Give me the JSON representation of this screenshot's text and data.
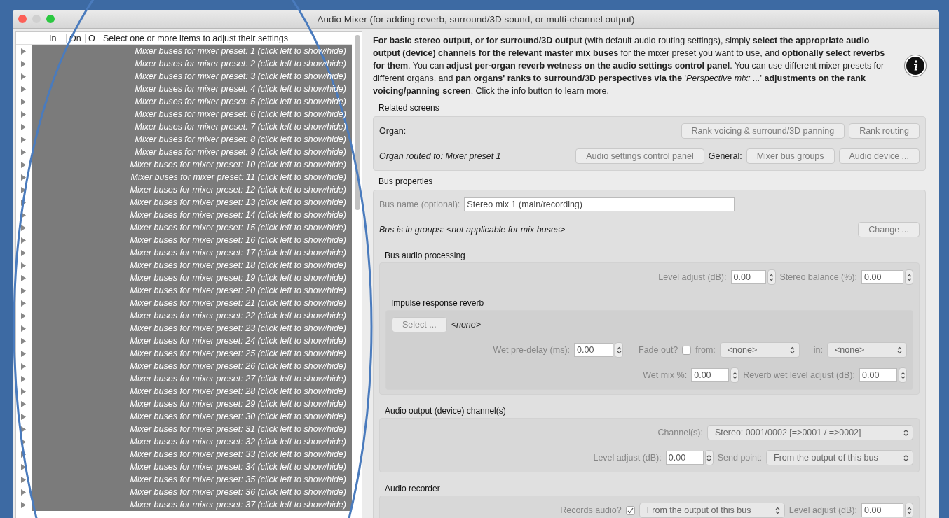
{
  "window": {
    "title": "Audio Mixer (for adding reverb, surround/3D sound, or multi-channel output)"
  },
  "list": {
    "columns": [
      "In",
      "On",
      "O",
      "Select one or more items to adjust their settings"
    ],
    "rows": [
      {
        "label": "Mixer buses for mixer preset: 1 (click left to show/hide)",
        "selected": true,
        "expanded": false
      },
      {
        "label": "Mixer buses for mixer preset: 2 (click left to show/hide)",
        "selected": true,
        "expanded": false
      },
      {
        "label": "Mixer buses for mixer preset: 3 (click left to show/hide)",
        "selected": true,
        "expanded": false
      },
      {
        "label": "Mixer buses for mixer preset: 4 (click left to show/hide)",
        "selected": true,
        "expanded": false
      },
      {
        "label": "Mixer buses for mixer preset: 5 (click left to show/hide)",
        "selected": true,
        "expanded": false
      },
      {
        "label": "Mixer buses for mixer preset: 6 (click left to show/hide)",
        "selected": true,
        "expanded": false
      },
      {
        "label": "Mixer buses for mixer preset: 7 (click left to show/hide)",
        "selected": true,
        "expanded": false
      },
      {
        "label": "Mixer buses for mixer preset: 8 (click left to show/hide)",
        "selected": true,
        "expanded": false
      },
      {
        "label": "Mixer buses for mixer preset: 9 (click left to show/hide)",
        "selected": true,
        "expanded": false
      },
      {
        "label": "Mixer buses for mixer preset: 10 (click left to show/hide)",
        "selected": true,
        "expanded": false
      },
      {
        "label": "Mixer buses for mixer preset: 11 (click left to show/hide)",
        "selected": true,
        "expanded": false
      },
      {
        "label": "Mixer buses for mixer preset: 12 (click left to show/hide)",
        "selected": true,
        "expanded": false
      },
      {
        "label": "Mixer buses for mixer preset: 13 (click left to show/hide)",
        "selected": true,
        "expanded": false
      },
      {
        "label": "Mixer buses for mixer preset: 14 (click left to show/hide)",
        "selected": true,
        "expanded": false
      },
      {
        "label": "Mixer buses for mixer preset: 15 (click left to show/hide)",
        "selected": true,
        "expanded": false
      },
      {
        "label": "Mixer buses for mixer preset: 16 (click left to show/hide)",
        "selected": true,
        "expanded": false
      },
      {
        "label": "Mixer buses for mixer preset: 17 (click left to show/hide)",
        "selected": true,
        "expanded": false
      },
      {
        "label": "Mixer buses for mixer preset: 18 (click left to show/hide)",
        "selected": true,
        "expanded": false
      },
      {
        "label": "Mixer buses for mixer preset: 19 (click left to show/hide)",
        "selected": true,
        "expanded": false
      },
      {
        "label": "Mixer buses for mixer preset: 20 (click left to show/hide)",
        "selected": true,
        "expanded": false
      },
      {
        "label": "Mixer buses for mixer preset: 21 (click left to show/hide)",
        "selected": true,
        "expanded": false
      },
      {
        "label": "Mixer buses for mixer preset: 22 (click left to show/hide)",
        "selected": true,
        "expanded": false
      },
      {
        "label": "Mixer buses for mixer preset: 23 (click left to show/hide)",
        "selected": true,
        "expanded": false
      },
      {
        "label": "Mixer buses for mixer preset: 24 (click left to show/hide)",
        "selected": true,
        "expanded": false
      },
      {
        "label": "Mixer buses for mixer preset: 25 (click left to show/hide)",
        "selected": true,
        "expanded": false
      },
      {
        "label": "Mixer buses for mixer preset: 26 (click left to show/hide)",
        "selected": true,
        "expanded": false
      },
      {
        "label": "Mixer buses for mixer preset: 27 (click left to show/hide)",
        "selected": true,
        "expanded": false
      },
      {
        "label": "Mixer buses for mixer preset: 28 (click left to show/hide)",
        "selected": true,
        "expanded": false
      },
      {
        "label": "Mixer buses for mixer preset: 29 (click left to show/hide)",
        "selected": true,
        "expanded": false
      },
      {
        "label": "Mixer buses for mixer preset: 30 (click left to show/hide)",
        "selected": true,
        "expanded": false
      },
      {
        "label": "Mixer buses for mixer preset: 31 (click left to show/hide)",
        "selected": true,
        "expanded": false
      },
      {
        "label": "Mixer buses for mixer preset: 32 (click left to show/hide)",
        "selected": true,
        "expanded": false
      },
      {
        "label": "Mixer buses for mixer preset: 33 (click left to show/hide)",
        "selected": true,
        "expanded": false
      },
      {
        "label": "Mixer buses for mixer preset: 34 (click left to show/hide)",
        "selected": true,
        "expanded": false
      },
      {
        "label": "Mixer buses for mixer preset: 35 (click left to show/hide)",
        "selected": true,
        "expanded": false
      },
      {
        "label": "Mixer buses for mixer preset: 36 (click left to show/hide)",
        "selected": true,
        "expanded": false
      },
      {
        "label": "Mixer buses for mixer preset: 37 (click left to show/hide)",
        "selected": true,
        "expanded": false
      }
    ]
  },
  "panel": {
    "description": "**For basic stereo output, or for surround/3D output** (with default audio routing settings), simply **select the appropriate audio output (device) channels for the relevant master mix buses** for the mixer preset you want to use, and **optionally select reverbs for them**. You can **adjust per-organ reverb wetness on the audio settings control panel**. You can use different mixer presets for different organs, and **pan organs' ranks to surround/3D perspectives via the** '*Perspective mix: ...*' **adjustments on the rank voicing/panning screen**. Click the info button to learn more.",
    "related_screens": {
      "title": "Related screens",
      "organ_label": "Organ:",
      "organ_buttons": [
        "Rank voicing & surround/3D panning",
        "Rank routing"
      ],
      "routed_label": "Organ routed to: Mixer preset 1",
      "routed_button": "Audio settings control panel",
      "general_label": "General:",
      "general_buttons": [
        "Mixer bus groups",
        "Audio device ..."
      ]
    },
    "bus_properties": {
      "title": "Bus properties",
      "name_label": "Bus name (optional):",
      "name_value": "Stereo mix 1 (main/recording)",
      "groups_text": "Bus is in groups: <not applicable for mix buses>",
      "change_button": "Change ...",
      "processing": {
        "title": "Bus audio processing",
        "level_label": "Level adjust (dB):",
        "level_value": "0.00",
        "balance_label": "Stereo balance (%):",
        "balance_value": "0.00",
        "reverb": {
          "title": "Impulse response reverb",
          "select_button": "Select ...",
          "file": "<none>",
          "predelay_label": "Wet pre-delay (ms):",
          "predelay_value": "0.00",
          "fade_label": "Fade out?",
          "fade_checked": false,
          "from_label": "from:",
          "from_value": "<none>",
          "in_label": "in:",
          "in_value": "<none>",
          "wetmix_label": "Wet mix %:",
          "wetmix_value": "0.00",
          "wetlevel_label": "Reverb wet level adjust (dB):",
          "wetlevel_value": "0.00"
        }
      },
      "output": {
        "title": "Audio output (device) channel(s)",
        "channels_label": "Channel(s):",
        "channels_value": "Stereo: 0001/0002 [=>0001 / =>0002]",
        "level_label": "Level adjust (dB):",
        "level_value": "0.00",
        "send_label": "Send point:",
        "send_value": "From the output of this bus"
      },
      "recorder": {
        "title": "Audio recorder",
        "records_label": "Records audio?",
        "records_checked": true,
        "source_value": "From the output of this bus",
        "level_label": "Level adjust (dB):",
        "level_value": "0.00"
      }
    }
  }
}
